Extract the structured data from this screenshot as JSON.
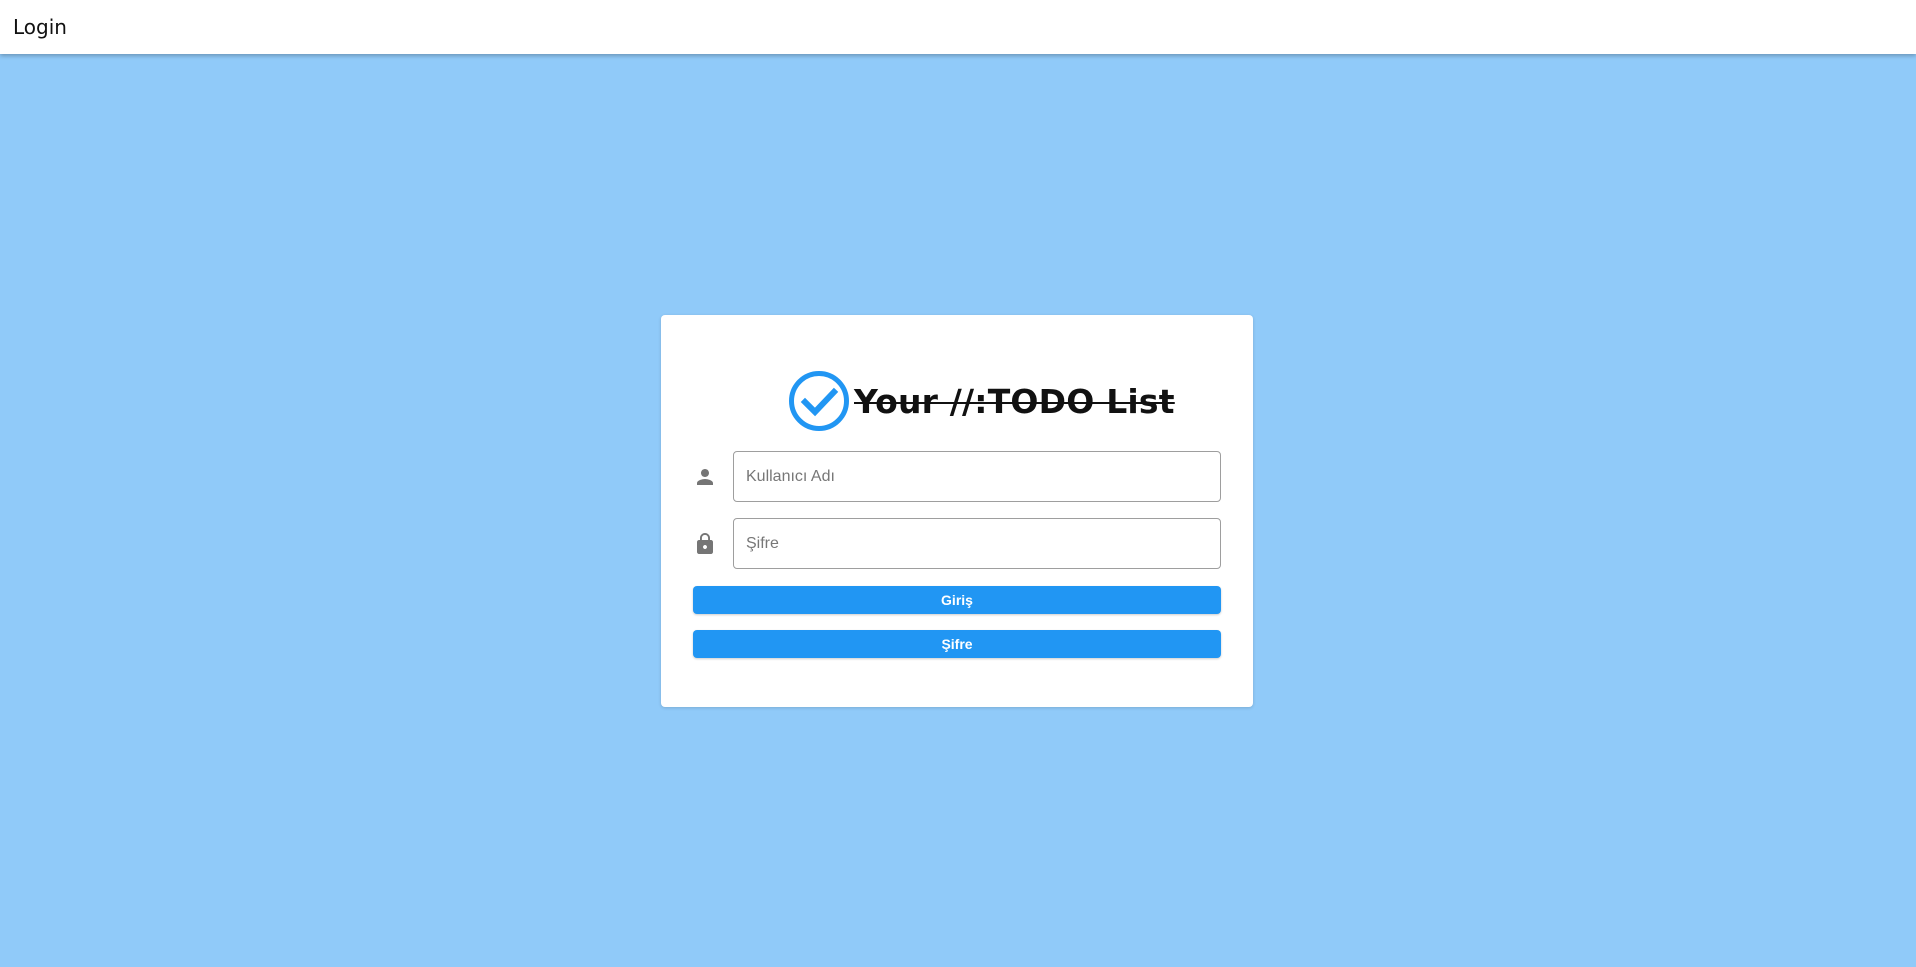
{
  "appbar": {
    "title": "Login"
  },
  "brand": {
    "icon": "check-circle-icon",
    "title": "Your //:TODO List",
    "accent_color": "#2196f3"
  },
  "form": {
    "username": {
      "icon": "person-icon",
      "placeholder": "Kullanıcı Adı",
      "value": ""
    },
    "password": {
      "icon": "lock-icon",
      "placeholder": "Şifre",
      "value": ""
    },
    "login_button_label": "Giriş",
    "password_button_label": "Şifre"
  },
  "colors": {
    "background": "#90caf9",
    "button": "#2196f3",
    "card": "#ffffff"
  }
}
